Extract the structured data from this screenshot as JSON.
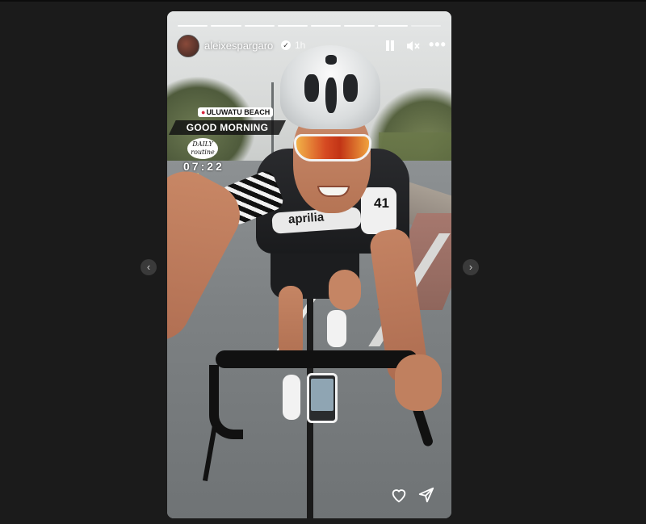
{
  "story": {
    "username": "aleixespargaro",
    "time_ago": "1h",
    "progress": {
      "segments": 8,
      "completed": 7
    },
    "stickers": {
      "location": "ULUWATU BEACH",
      "greeting": "GOOD MORNING",
      "daily_line1": "DAILY",
      "daily_line2": "routine",
      "time": "07:22"
    },
    "jersey": {
      "brand": "aprilia",
      "number": "41"
    },
    "header_icons": [
      "pause-icon",
      "mute-icon",
      "more-icon"
    ],
    "footer_icons": [
      "heart-icon",
      "send-icon"
    ]
  },
  "navigation": {
    "prev_symbol": "‹",
    "next_symbol": "›"
  },
  "colors": {
    "page_background": "#1b1b1b",
    "location_pin": "#d7263d"
  }
}
